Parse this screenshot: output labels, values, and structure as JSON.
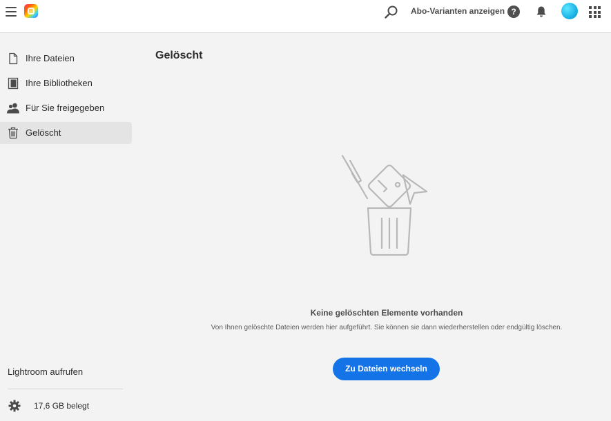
{
  "header": {
    "plans_link": "Abo-Varianten anzeigen",
    "help_glyph": "?",
    "icons": [
      "menu-icon",
      "creative-cloud-logo",
      "search-icon",
      "help-icon",
      "bell-icon",
      "avatar",
      "apps-grid-icon"
    ]
  },
  "sidebar": {
    "items": [
      {
        "label": "Ihre Dateien",
        "icon": "file-icon",
        "active": false
      },
      {
        "label": "Ihre Bibliotheken",
        "icon": "library-icon",
        "active": false
      },
      {
        "label": "Für Sie freigegeben",
        "icon": "shared-users-icon",
        "active": false
      },
      {
        "label": "Gelöscht",
        "icon": "trash-icon",
        "active": true
      }
    ],
    "lightroom_link": "Lightroom aufrufen",
    "storage": "17,6 GB belegt"
  },
  "main": {
    "title": "Gelöscht",
    "empty_state": {
      "title": "Keine gelöschten Elemente vorhanden",
      "description": "Von Ihnen gelöschte Dateien werden hier aufgeführt. Sie können sie dann wiederherstellen oder endgültig löschen.",
      "button": "Zu Dateien wechseln"
    }
  },
  "colors": {
    "accent": "#1473e6",
    "active_nav_bg": "#e4e4e4",
    "background": "#f3f3f3"
  }
}
